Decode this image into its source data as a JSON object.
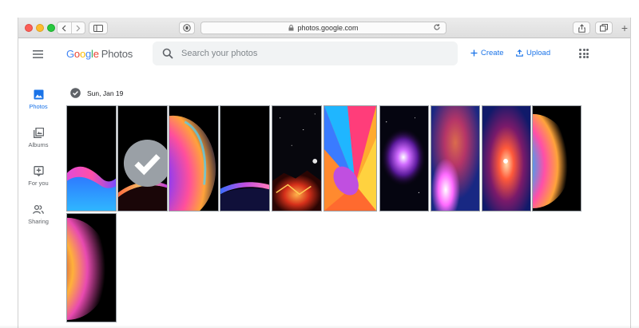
{
  "browser": {
    "url": "photos.google.com",
    "new_tab_label": "+"
  },
  "app": {
    "logo_word1": "Google",
    "logo_word2": "Photos",
    "search_placeholder": "Search your photos",
    "create_label": "Create",
    "upload_label": "Upload"
  },
  "nav": {
    "items": [
      {
        "label": "Photos",
        "icon": "photo-icon",
        "active": true
      },
      {
        "label": "Albums",
        "icon": "albums-icon",
        "active": false
      },
      {
        "label": "For you",
        "icon": "for-you-icon",
        "active": false
      },
      {
        "label": "Sharing",
        "icon": "sharing-icon",
        "active": false
      }
    ]
  },
  "content": {
    "date_label": "Sun, Jan 19",
    "photos": [
      {
        "name": "blue-pink-wave-wallpaper",
        "selected": false
      },
      {
        "name": "dark-orb-edge-wallpaper",
        "selected": true
      },
      {
        "name": "colorful-planet-wallpaper",
        "selected": false
      },
      {
        "name": "dark-curve-wallpaper",
        "selected": false
      },
      {
        "name": "lava-landscape-wallpaper",
        "selected": false
      },
      {
        "name": "rainbow-rays-wallpaper",
        "selected": false
      },
      {
        "name": "purple-galaxy-wallpaper",
        "selected": false
      },
      {
        "name": "blue-nebula-wallpaper",
        "selected": false
      },
      {
        "name": "red-nebula-wallpaper",
        "selected": false
      },
      {
        "name": "blue-orb-wallpaper",
        "selected": false
      },
      {
        "name": "golden-orb-wallpaper",
        "selected": false
      }
    ]
  },
  "colors": {
    "accent": "#1a73e8",
    "text_secondary": "#5f6368",
    "search_bg": "#f1f3f4"
  }
}
